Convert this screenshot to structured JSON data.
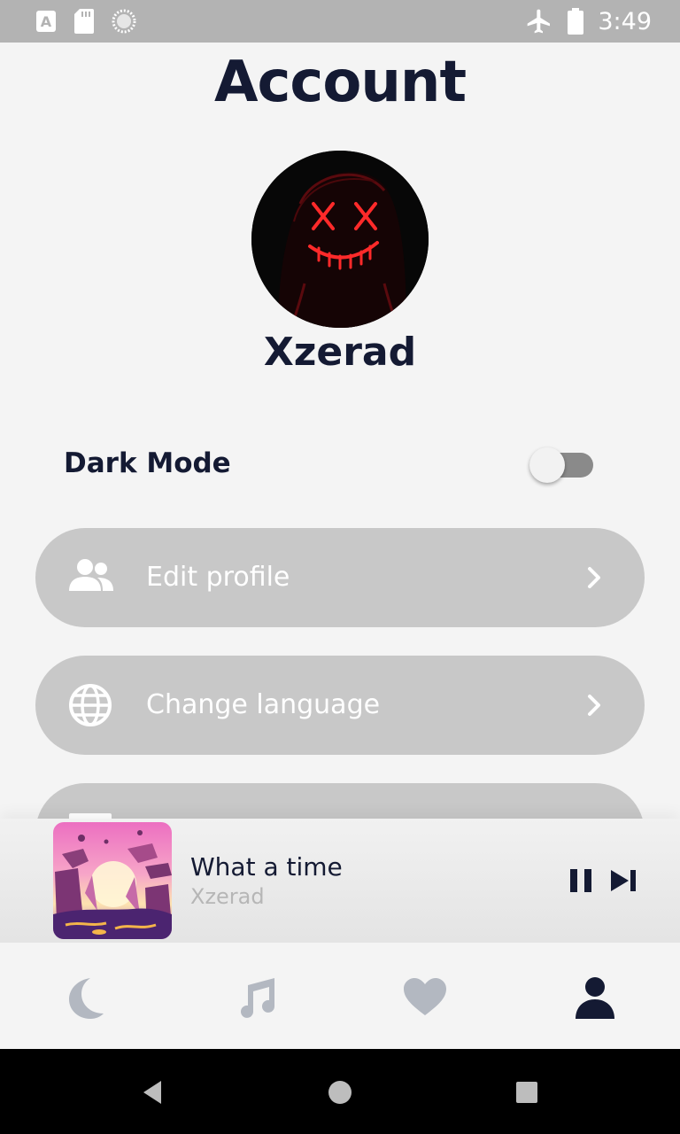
{
  "status_bar": {
    "time": "3:49",
    "icons": [
      "text-a-icon",
      "sd-card-icon",
      "sync-icon",
      "airplane-icon",
      "battery-icon"
    ]
  },
  "page": {
    "title": "Account"
  },
  "profile": {
    "username": "Xzerad",
    "avatar": "avatar-neon-mask-image"
  },
  "settings": {
    "dark_mode_label": "Dark Mode",
    "dark_mode_enabled": false
  },
  "menu": {
    "items": [
      {
        "label": "Edit profile",
        "icon": "users-icon"
      },
      {
        "label": "Change language",
        "icon": "globe-icon"
      },
      {
        "label": "",
        "icon": "document-icon"
      }
    ]
  },
  "player": {
    "title": "What a time",
    "artist": "Xzerad",
    "state": "playing"
  },
  "bottom_nav": {
    "items": [
      {
        "icon": "moon-icon",
        "active": false
      },
      {
        "icon": "music-note-icon",
        "active": false
      },
      {
        "icon": "heart-icon",
        "active": false
      },
      {
        "icon": "person-icon",
        "active": true
      }
    ]
  },
  "colors": {
    "primary_text": "#141a33",
    "menu_bg": "#c8c8c8",
    "inactive_icon": "#b3b8c1",
    "background": "#f4f4f4"
  }
}
